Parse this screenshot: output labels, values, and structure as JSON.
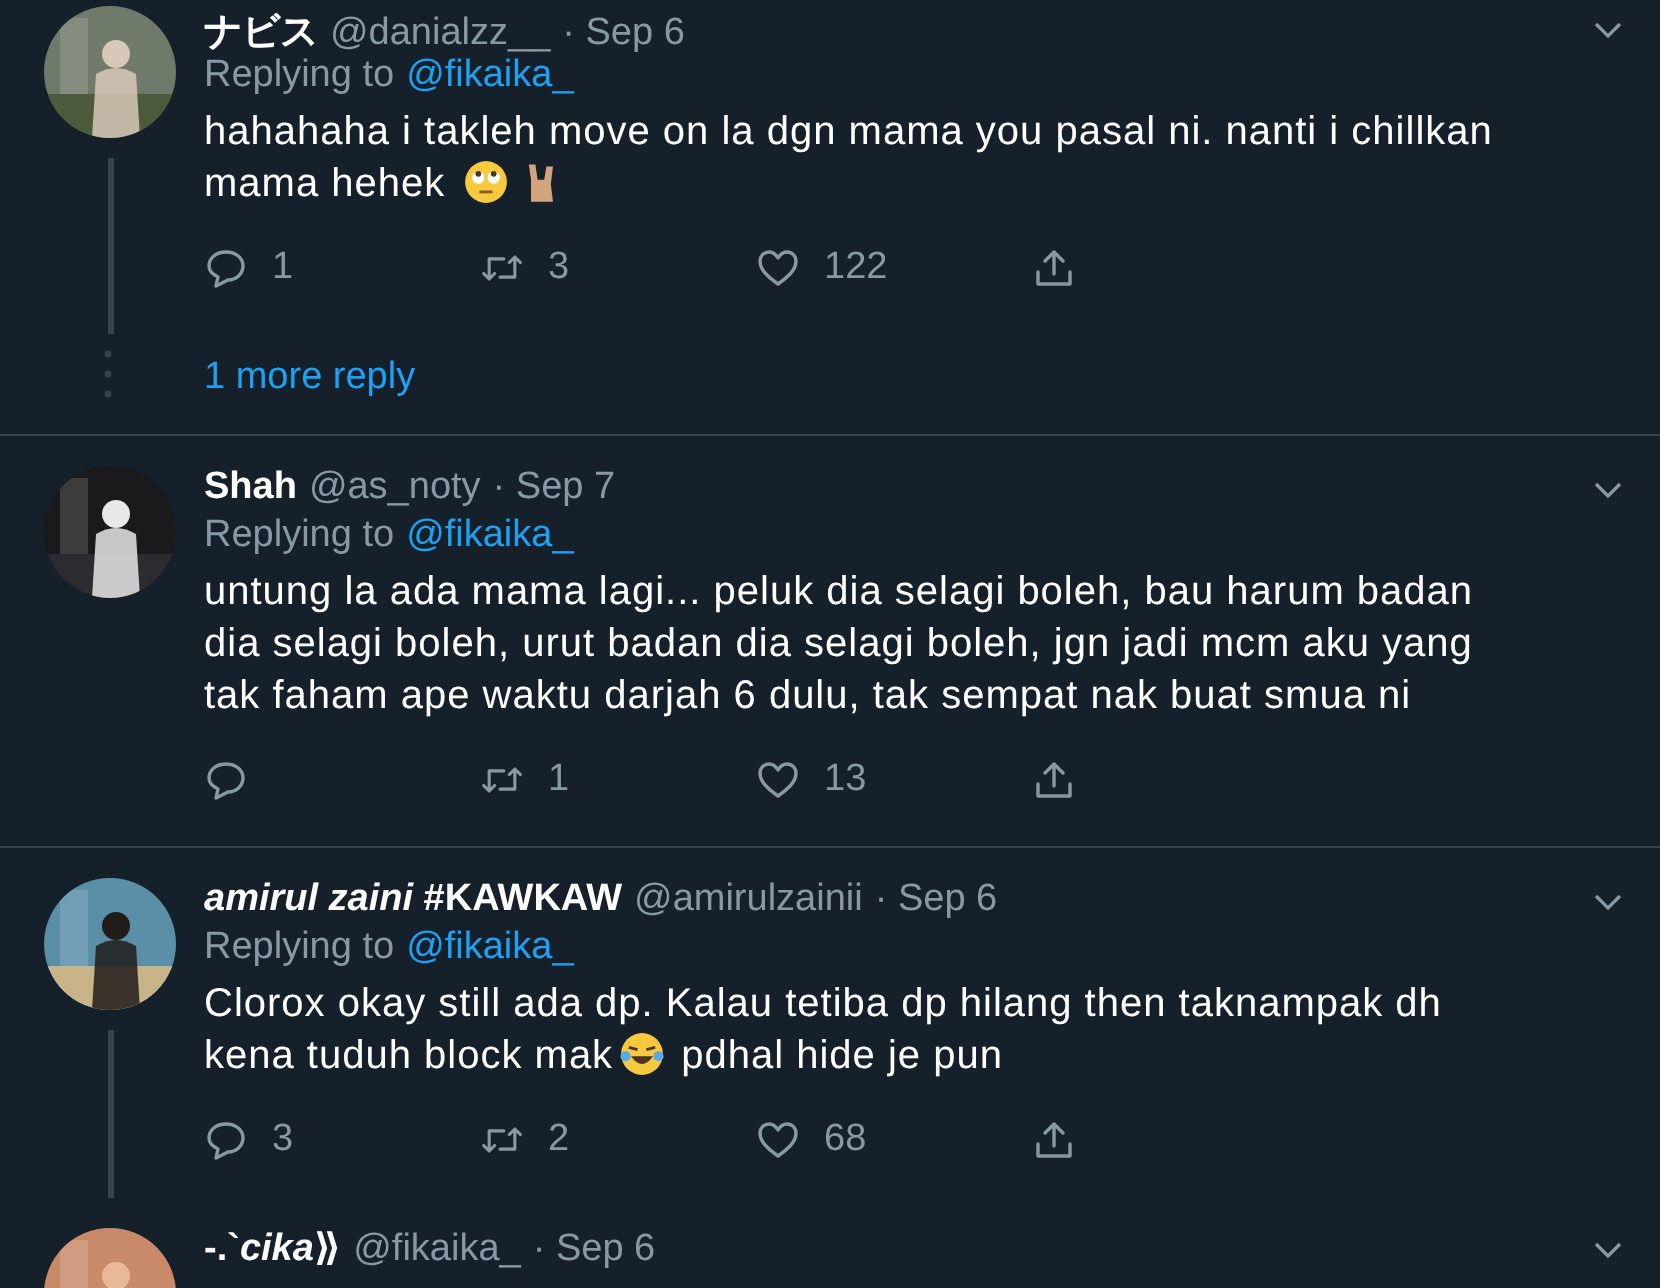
{
  "tweets": [
    {
      "name": "ナビス",
      "handle": "@danialzz__",
      "date": "· Sep 6",
      "replying_label": "Replying to",
      "replying_to": "@fikaika_",
      "thread_line": true,
      "body": [
        {
          "kind": "text",
          "text": "hahahaha i takleh move on la dgn mama you pasal ni. nanti i chillkan mama hehek "
        },
        {
          "kind": "eyeroll"
        },
        {
          "kind": "horns"
        }
      ],
      "actions": {
        "replies": "1",
        "retweets": "3",
        "likes": "122"
      },
      "more_replies": "1 more reply"
    },
    {
      "name": "Shah",
      "handle": "@as_noty",
      "date": "· Sep 7",
      "replying_label": "Replying to",
      "replying_to": "@fikaika_",
      "thread_line": false,
      "body": [
        {
          "kind": "text",
          "text": "untung la ada mama lagi... peluk dia selagi boleh, bau harum badan dia selagi boleh, urut badan dia selagi boleh, jgn jadi mcm aku yang tak faham ape waktu darjah 6 dulu, tak sempat nak buat smua ni"
        }
      ],
      "actions": {
        "retweets": "1",
        "likes": "13"
      }
    },
    {
      "name": "*amirul zaini* #KAWKAW",
      "handle": "@amirulzainii",
      "date": "· Sep 6",
      "replying_label": "Replying to",
      "replying_to": "@fikaika_",
      "thread_line": true,
      "body": [
        {
          "kind": "text",
          "text": "Clorox okay still ada dp. Kalau tetiba dp hilang then taknampak dh kena tuduh block mak"
        },
        {
          "kind": "tears"
        },
        {
          "kind": "text",
          "text": " pdhal hide je pun"
        }
      ],
      "actions": {
        "replies": "3",
        "retweets": "2",
        "likes": "68"
      }
    },
    {
      "name": "-.`*cika*⟫",
      "handle": "@fikaika_",
      "date": "· Sep 6",
      "thread_line": false
    }
  ]
}
